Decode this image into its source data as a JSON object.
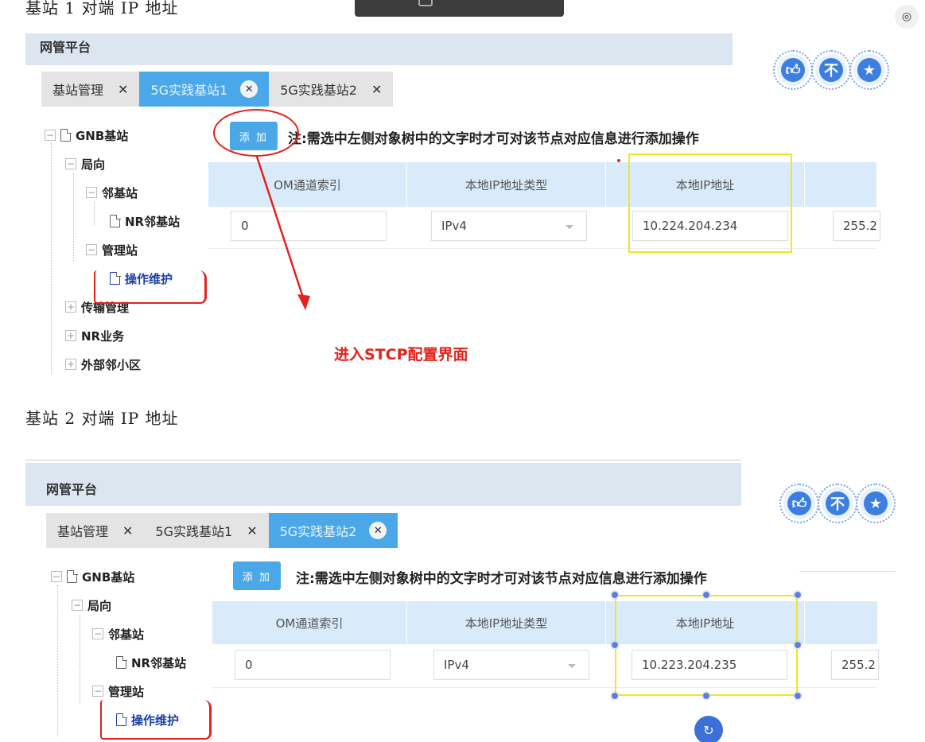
{
  "captions": {
    "site1": "基站 1 对端 IP 地址",
    "site2": "基站 2 对端 IP 地址"
  },
  "panel1": {
    "platform_title": "网管平台",
    "tabs": [
      {
        "label": "基站管理",
        "active": false
      },
      {
        "label": "5G实践基站1",
        "active": true
      },
      {
        "label": "5G实践基站2",
        "active": false
      }
    ],
    "tree": {
      "root": "GNB基站",
      "direction": "局向",
      "neighbor_site": "邻基站",
      "nr_neighbor": "NR邻基站",
      "mgmt_site": "管理站",
      "om": "操作维护",
      "transport": "传输管理",
      "nr_service": "NR业务",
      "external_cell": "外部邻小区"
    },
    "add_label": "添 加",
    "note": "注:需选中左侧对象树中的文字时才可对该节点对应信息进行添加操作",
    "columns": [
      "OM通道索引",
      "本地IP地址类型",
      "本地IP地址"
    ],
    "row": {
      "om_index": "0",
      "ip_type": "IPv4",
      "local_ip": "10.224.204.234",
      "mask_partial": "255.2"
    },
    "annotation": "进入STCP配置界面"
  },
  "panel2": {
    "platform_title": "网管平台",
    "tabs": [
      {
        "label": "基站管理",
        "active": false
      },
      {
        "label": "5G实践基站1",
        "active": false
      },
      {
        "label": "5G实践基站2",
        "active": true
      }
    ],
    "tree": {
      "root": "GNB基站",
      "direction": "局向",
      "neighbor_site": "邻基站",
      "nr_neighbor": "NR邻基站",
      "mgmt_site": "管理站",
      "om": "操作维护"
    },
    "add_label": "添 加",
    "note": "注:需选中左侧对象树中的文字时才可对该节点对应信息进行添加操作",
    "columns": [
      "OM通道索引",
      "本地IP地址类型",
      "本地IP地址"
    ],
    "row": {
      "om_index": "0",
      "ip_type": "IPv4",
      "local_ip": "10.223.204.235",
      "mask_partial": "255.2"
    }
  },
  "colors": {
    "accent": "#4aa8e8",
    "highlight": "#f0e626",
    "annotation_red": "#e3231c",
    "header_bg": "#d9ebfa"
  },
  "icons": {
    "scan": "scan-icon",
    "like": "thumbs-up-icon",
    "dislike": "thumbs-down-icon",
    "favorite": "star-icon"
  }
}
